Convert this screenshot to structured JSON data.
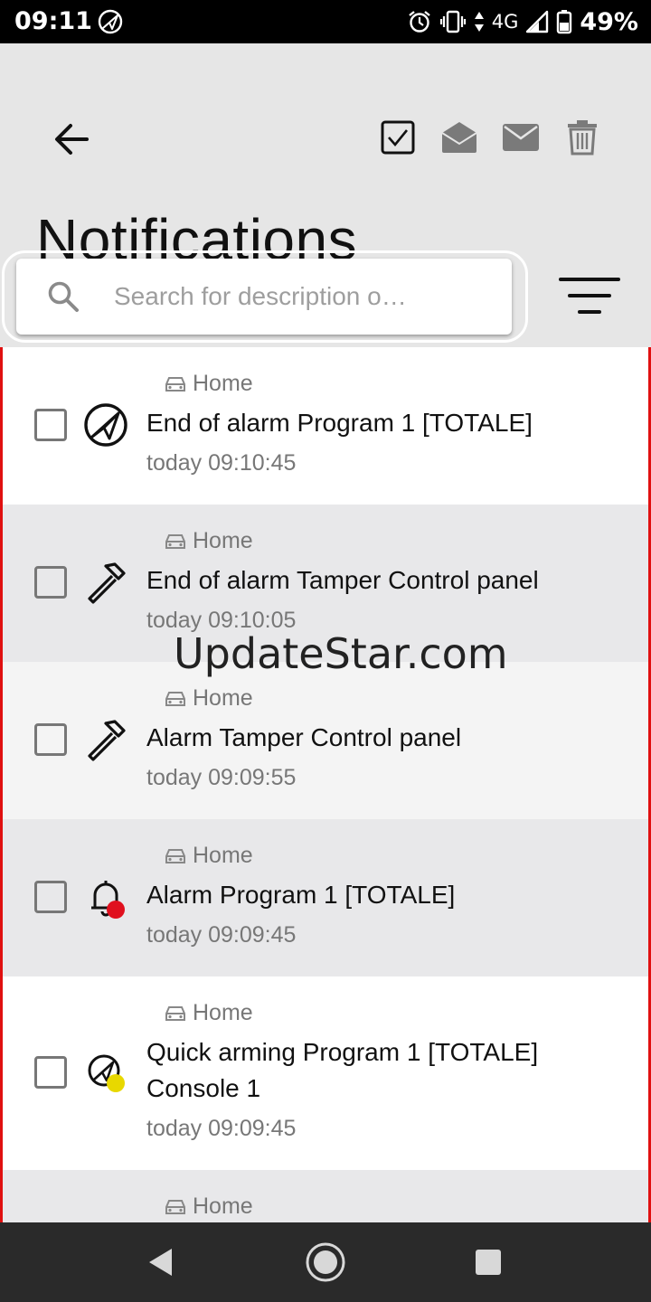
{
  "status_bar": {
    "time": "09:11",
    "network": "4G",
    "battery": "49%",
    "icons": [
      "app-notification-icon",
      "alarm-clock-icon",
      "vibrate-icon",
      "data-arrows-icon",
      "signal-icon",
      "battery-icon"
    ]
  },
  "header": {
    "title": "Notifications",
    "toolbar_icons": [
      "check-all-icon",
      "mark-read-icon",
      "mark-unread-icon",
      "trash-icon"
    ]
  },
  "search": {
    "placeholder": "Search for description o…",
    "value": ""
  },
  "notifications": [
    {
      "group": "Home",
      "title": "End of alarm Program 1 [TOTALE]",
      "time": "today 09:10:45",
      "icon": "program-disarm-icon",
      "badge": ""
    },
    {
      "group": "Home",
      "title": "End of alarm Tamper Control panel",
      "time": "today 09:10:05",
      "icon": "hammer-icon",
      "badge": ""
    },
    {
      "group": "Home",
      "title": "Alarm Tamper Control panel",
      "time": "today 09:09:55",
      "icon": "hammer-icon",
      "badge": ""
    },
    {
      "group": "Home",
      "title": "Alarm Program 1 [TOTALE]",
      "time": "today 09:09:45",
      "icon": "bell-icon",
      "badge": "red"
    },
    {
      "group": "Home",
      "title": "Quick arming Program 1 [TOTALE] Console 1",
      "time": "today 09:09:45",
      "icon": "program-arm-icon",
      "badge": "yellow"
    },
    {
      "group": "Home",
      "title": "",
      "time": "",
      "icon": "",
      "badge": ""
    }
  ],
  "watermark": "UpdateStar.com",
  "colors": {
    "accent_border": "#e01010",
    "badge_red": "#e0101e",
    "badge_yellow": "#e8d800",
    "row_alt": "#e8e8ea",
    "row_light": "#f4f4f4"
  }
}
